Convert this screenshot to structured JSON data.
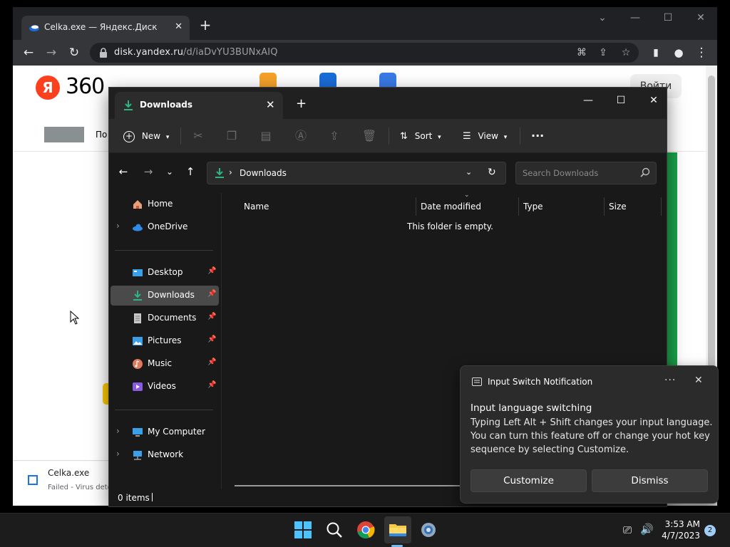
{
  "browser": {
    "tab_title": "Celka.exe — Яндекс.Диск",
    "url_host": "disk.yandex.ru",
    "url_path": "/d/iaDvYU3BUNxAIQ"
  },
  "page": {
    "logo_letter": "Я",
    "logo_text": "360",
    "nav_partial": "По",
    "login_label": "Войти",
    "download": {
      "file_name": "Celka.exe",
      "status": "Failed - Virus detec"
    }
  },
  "explorer": {
    "tab_title": "Downloads",
    "commands": {
      "new_label": "New",
      "sort_label": "Sort",
      "view_label": "View",
      "more_label": "···"
    },
    "address_label": "Downloads",
    "search_placeholder": "Search Downloads",
    "sidebar": {
      "items": [
        {
          "label": "Home"
        },
        {
          "label": "OneDrive"
        },
        {
          "label": "Desktop"
        },
        {
          "label": "Downloads"
        },
        {
          "label": "Documents"
        },
        {
          "label": "Pictures"
        },
        {
          "label": "Music"
        },
        {
          "label": "Videos"
        },
        {
          "label": "My Computer"
        },
        {
          "label": "Network"
        }
      ]
    },
    "columns": [
      "Name",
      "Date modified",
      "Type",
      "Size"
    ],
    "empty_message": "This folder is empty.",
    "status_text": "0 items"
  },
  "toast": {
    "app_name": "Input Switch Notification",
    "title": "Input language switching",
    "body": "Typing Left Alt + Shift changes your input language. You can turn this feature off or change your hot key sequence by selecting Customize.",
    "customize_label": "Customize",
    "dismiss_label": "Dismiss"
  },
  "taskbar": {
    "time": "3:53 AM",
    "date": "4/7/2023",
    "notification_count": "2"
  },
  "colors": {
    "accent": "#76b9ed",
    "download_green": "#2fb583",
    "yandex_red": "#fc3f1d"
  }
}
